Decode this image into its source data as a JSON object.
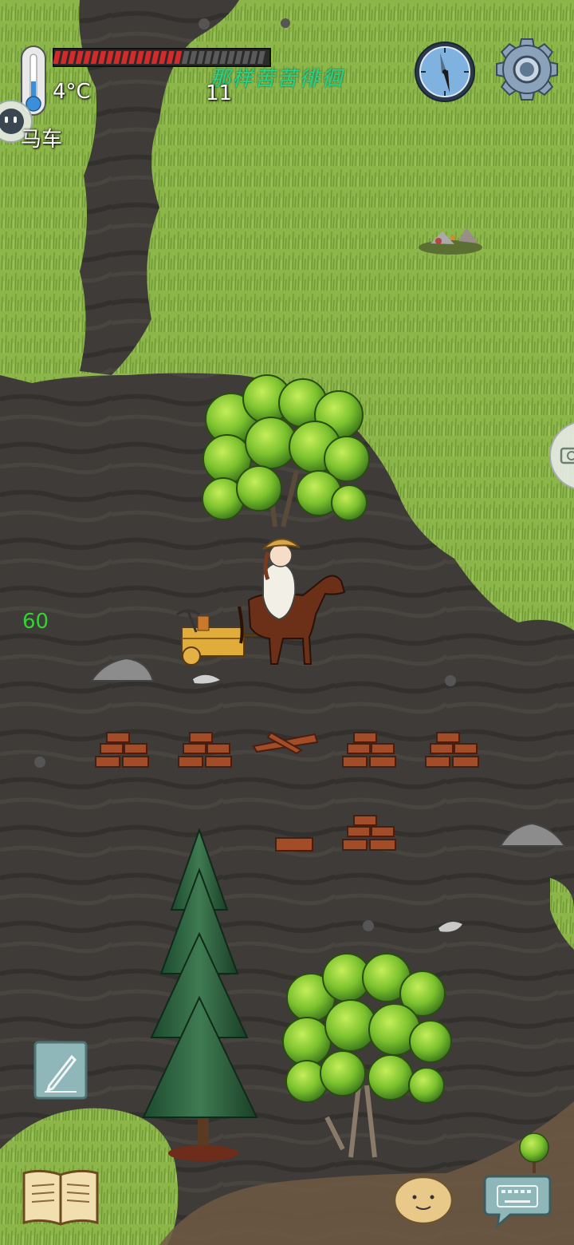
{
  "hud": {
    "temperature": "4°C",
    "health_fraction": 0.61,
    "player_name": "那样苦苦徘徊",
    "age": "11",
    "vehicle_label": "马车",
    "fps": "60"
  },
  "icons": {
    "thermometer": "thermometer-icon",
    "compass": "compass-icon",
    "settings": "gear-icon",
    "chat": "chat-bubble-icon",
    "camera": "camera-icon",
    "note": "pencil-note-icon",
    "book": "open-book-icon",
    "emote": "potato-face-icon",
    "keyboard": "keyboard-icon"
  },
  "colors": {
    "health_red": "#d42a2a",
    "name_green": "#29d38a",
    "fps_green": "#35d235",
    "grass": "#86b045",
    "dirt": "#3f3b37"
  }
}
